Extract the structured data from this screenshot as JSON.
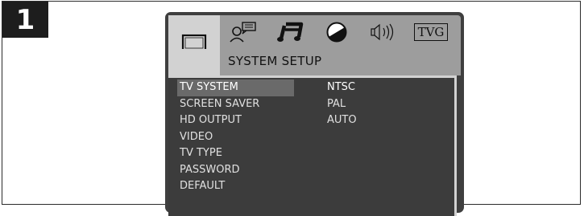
{
  "step": {
    "number": "1"
  },
  "tabs": [
    {
      "id": "system",
      "icon": "tv-monitor-icon",
      "active": true
    },
    {
      "id": "language",
      "icon": "speech-person-icon",
      "active": false
    },
    {
      "id": "audio",
      "icon": "music-note-icon",
      "active": false
    },
    {
      "id": "video",
      "icon": "picture-circle-icon",
      "active": false
    },
    {
      "id": "speaker",
      "icon": "speaker-icon",
      "active": false
    },
    {
      "id": "tvg",
      "label": "TVG",
      "active": false
    }
  ],
  "screen": {
    "title": "SYSTEM SETUP"
  },
  "menu": {
    "items": [
      "TV SYSTEM",
      "SCREEN SAVER",
      "HD OUTPUT",
      "VIDEO",
      "TV TYPE",
      "PASSWORD",
      "DEFAULT"
    ],
    "selected_index": 0
  },
  "options": {
    "items": [
      "NTSC",
      "PAL",
      "AUTO"
    ],
    "selected_index": 0
  },
  "colors": {
    "osd_bg": "#3f3f3f",
    "tab_bar": "#9d9d9d",
    "active_tab": "#d2d2d2",
    "highlight": "#6a6a6a"
  }
}
